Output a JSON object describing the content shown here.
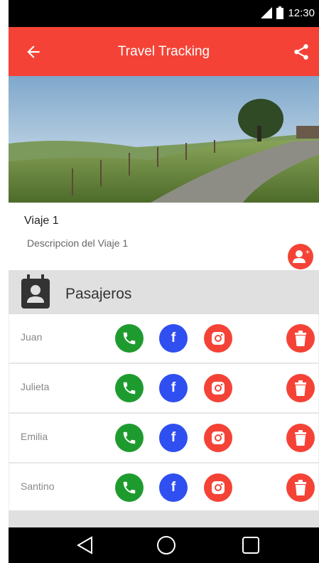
{
  "status_bar": {
    "time": "12:30"
  },
  "app_bar": {
    "title": "Travel Tracking"
  },
  "trip": {
    "name": "Viaje 1",
    "description": "Descripcion del Viaje 1"
  },
  "section": {
    "title": "Pasajeros"
  },
  "passengers": [
    {
      "name": "Juan"
    },
    {
      "name": "Julieta"
    },
    {
      "name": "Emilia"
    },
    {
      "name": "Santino"
    }
  ],
  "icons": {
    "back": "arrow-left-icon",
    "share": "share-icon",
    "add_passenger": "add-person-icon",
    "contacts": "contact-card-icon",
    "phone": "phone-icon",
    "facebook": "facebook-icon",
    "instagram": "instagram-icon",
    "delete": "trash-icon",
    "nav_back": "triangle-back-icon",
    "nav_home": "circle-home-icon",
    "nav_recent": "square-recent-icon"
  },
  "colors": {
    "primary": "#f44336",
    "phone": "#1e9b2e",
    "facebook": "#2f4ff0",
    "section_bg": "#e0e0e0"
  },
  "facebook_glyph": "f"
}
